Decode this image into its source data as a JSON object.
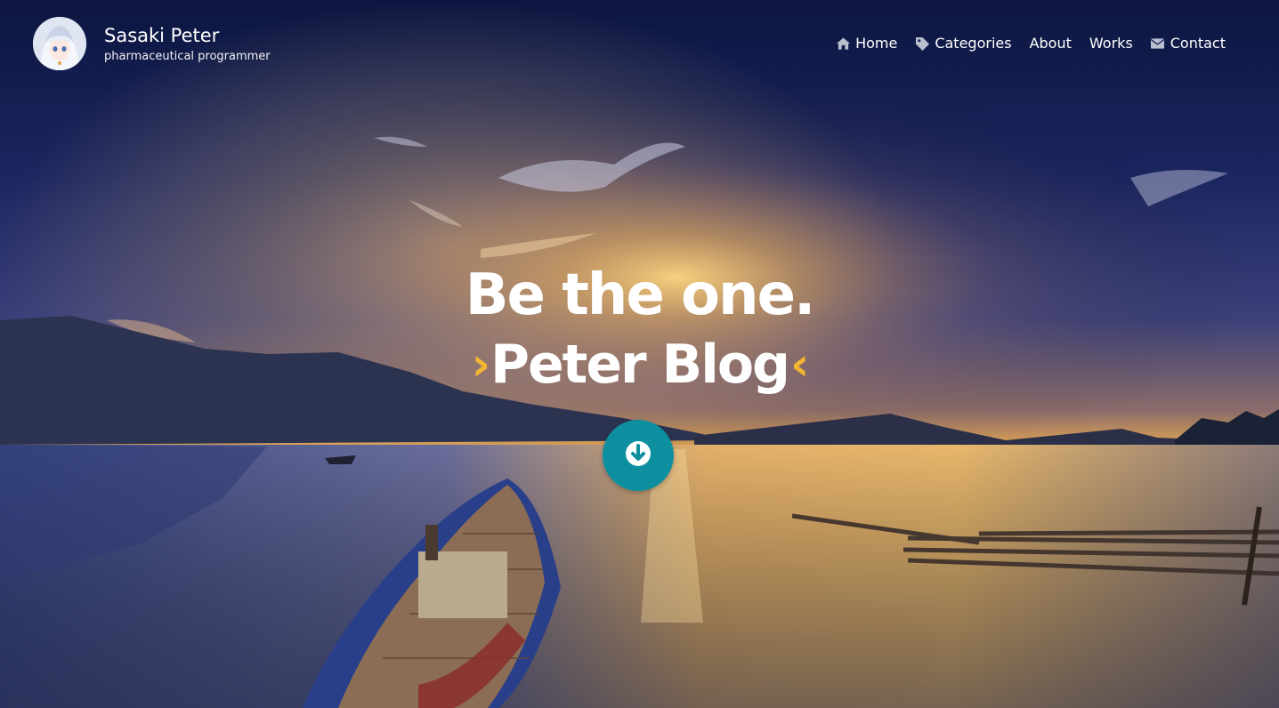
{
  "site": {
    "name": "Sasaki Peter",
    "tagline": "pharmaceutical programmer"
  },
  "nav": {
    "items": [
      {
        "label": "Home",
        "icon": "home-icon"
      },
      {
        "label": "Categories",
        "icon": "tag-icon"
      },
      {
        "label": "About",
        "icon": ""
      },
      {
        "label": "Works",
        "icon": ""
      },
      {
        "label": "Contact",
        "icon": "envelope-icon"
      }
    ]
  },
  "hero": {
    "headline": "Be the one.",
    "blog_title": "Peter Blog",
    "left_chevron": "›",
    "right_chevron": "‹",
    "scroll_icon": "arrow-down-icon"
  },
  "colors": {
    "accent": "#0e8fa0",
    "chevron": "#f2b533",
    "text": "#ffffff"
  }
}
